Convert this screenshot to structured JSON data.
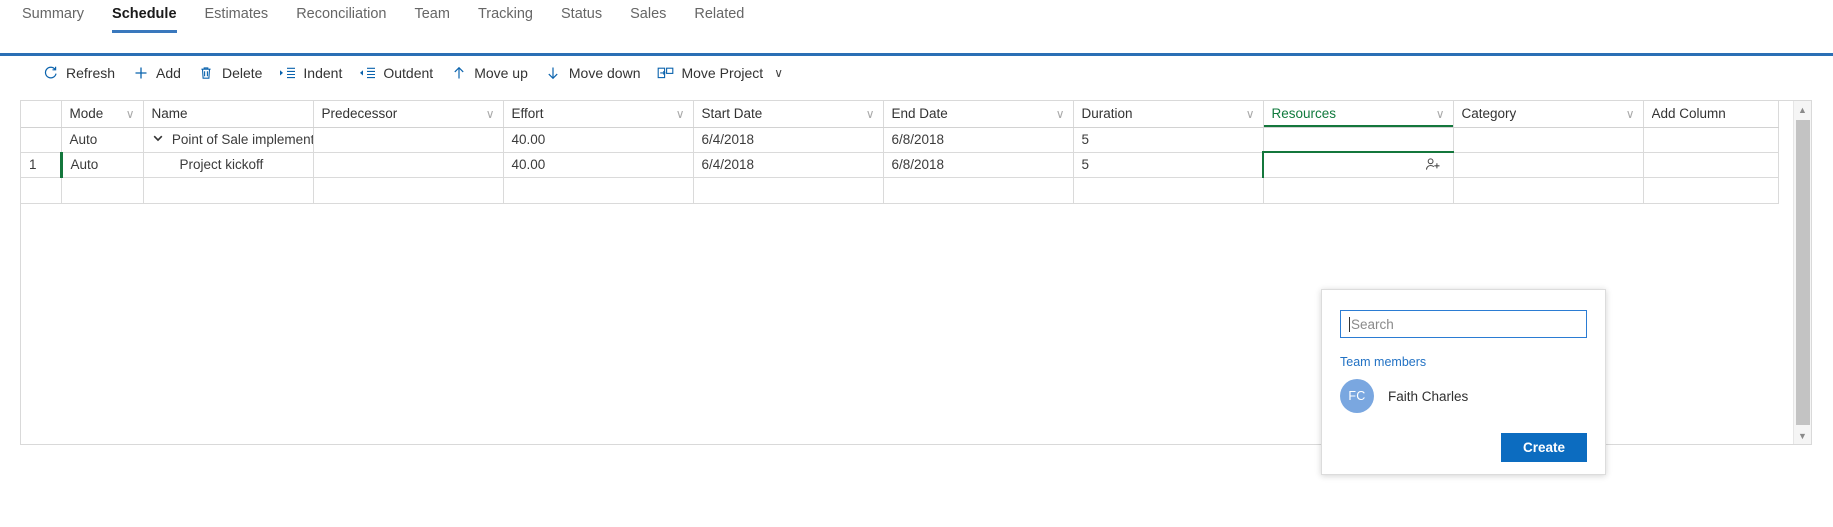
{
  "tabs": [
    {
      "label": "Summary",
      "active": false
    },
    {
      "label": "Schedule",
      "active": true
    },
    {
      "label": "Estimates",
      "active": false
    },
    {
      "label": "Reconciliation",
      "active": false
    },
    {
      "label": "Team",
      "active": false
    },
    {
      "label": "Tracking",
      "active": false
    },
    {
      "label": "Status",
      "active": false
    },
    {
      "label": "Sales",
      "active": false
    },
    {
      "label": "Related",
      "active": false
    }
  ],
  "commandbar": {
    "items": [
      {
        "label": "Refresh",
        "icon": "refresh-icon"
      },
      {
        "label": "Add",
        "icon": "plus-icon"
      },
      {
        "label": "Delete",
        "icon": "trash-icon"
      },
      {
        "label": "Indent",
        "icon": "indent-icon"
      },
      {
        "label": "Outdent",
        "icon": "outdent-icon"
      },
      {
        "label": "Move up",
        "icon": "arrow-up-icon"
      },
      {
        "label": "Move down",
        "icon": "arrow-down-icon"
      },
      {
        "label": "Move Project",
        "icon": "move-project-icon",
        "chevron": "∨"
      }
    ]
  },
  "grid": {
    "columns": [
      {
        "label": "",
        "filter": false
      },
      {
        "label": "Mode",
        "filter": true
      },
      {
        "label": "Name",
        "filter": false
      },
      {
        "label": "Predecessor",
        "filter": true
      },
      {
        "label": "Effort",
        "filter": true
      },
      {
        "label": "Start Date",
        "filter": true
      },
      {
        "label": "End Date",
        "filter": true
      },
      {
        "label": "Duration",
        "filter": true
      },
      {
        "label": "Resources",
        "filter": true
      },
      {
        "label": "Category",
        "filter": true
      },
      {
        "label": "Add Column",
        "filter": false
      }
    ],
    "rows": [
      {
        "rownum": "",
        "mode": "Auto",
        "name": "Point of Sale implementati",
        "predecessor": "",
        "effort": "40.00",
        "start_date": "6/4/2018",
        "end_date": "6/8/2018",
        "duration": "5",
        "resources": "",
        "category": "",
        "expander": "⌄",
        "selected": false,
        "indent": 0
      },
      {
        "rownum": "1",
        "mode": "Auto",
        "name": "Project kickoff",
        "predecessor": "",
        "effort": "40.00",
        "start_date": "6/4/2018",
        "end_date": "6/8/2018",
        "duration": "5",
        "resources": "",
        "category": "",
        "expander": "",
        "selected": true,
        "indent": 1
      }
    ],
    "selected_cell_icon": "person-add-icon",
    "accent_selection_color": "#14773c"
  },
  "resource_flyout": {
    "search_placeholder": "Search",
    "search_value": "",
    "group_label": "Team members",
    "people": [
      {
        "initials": "FC",
        "name": "Faith Charles",
        "avatar_color": "#7aa7e0"
      }
    ],
    "create_label": "Create"
  },
  "scrollbar": {
    "up_arrow": "▲",
    "down_arrow": "▼"
  },
  "colors": {
    "tab_accent": "#3a78bd",
    "header_rule": "#2a6fb5",
    "selection_green": "#14773c",
    "primary_blue": "#0c6cc0",
    "icon_blue": "#0b63ad"
  }
}
